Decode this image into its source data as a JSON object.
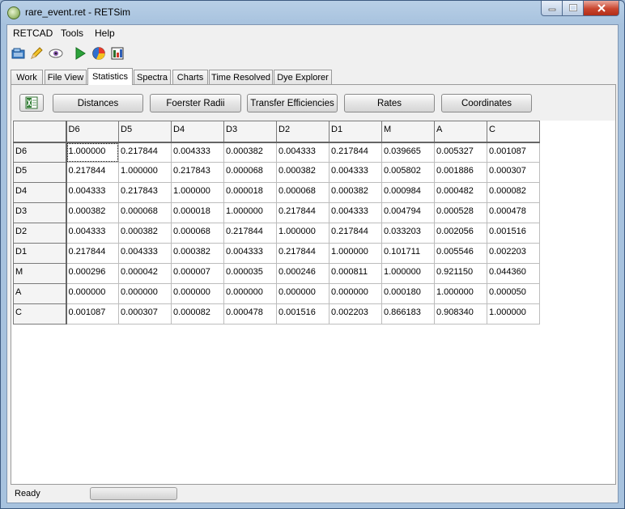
{
  "window": {
    "title": "rare_event.ret - RETSim"
  },
  "menu": [
    "RETCAD",
    "Tools",
    "Help"
  ],
  "toolbar": {
    "icons": [
      "open-folder-icon",
      "pencil-icon",
      "eye-icon",
      "play-icon",
      "pie-chart-icon",
      "spreadsheet-icon"
    ]
  },
  "tabs": [
    {
      "label": "Work",
      "active": false
    },
    {
      "label": "File View",
      "active": false
    },
    {
      "label": "Statistics",
      "active": true
    },
    {
      "label": "Spectra",
      "active": false
    },
    {
      "label": "Charts",
      "active": false
    },
    {
      "label": "Time Resolved",
      "active": false
    },
    {
      "label": "Dye Explorer",
      "active": false
    }
  ],
  "buttons": {
    "distances": "Distances",
    "foerster_radii": "Foerster Radii",
    "transfer_efficiencies": "Transfer Efficiencies",
    "rates": "Rates",
    "coordinates": "Coordinates"
  },
  "grid": {
    "columns": [
      "D6",
      "D5",
      "D4",
      "D3",
      "D2",
      "D1",
      "M",
      "A",
      "C"
    ],
    "rows": [
      {
        "label": "D6",
        "values": [
          "1.000000",
          "0.217844",
          "0.004333",
          "0.000382",
          "0.004333",
          "0.217844",
          "0.039665",
          "0.005327",
          "0.001087"
        ]
      },
      {
        "label": "D5",
        "values": [
          "0.217844",
          "1.000000",
          "0.217843",
          "0.000068",
          "0.000382",
          "0.004333",
          "0.005802",
          "0.001886",
          "0.000307"
        ]
      },
      {
        "label": "D4",
        "values": [
          "0.004333",
          "0.217843",
          "1.000000",
          "0.000018",
          "0.000068",
          "0.000382",
          "0.000984",
          "0.000482",
          "0.000082"
        ]
      },
      {
        "label": "D3",
        "values": [
          "0.000382",
          "0.000068",
          "0.000018",
          "1.000000",
          "0.217844",
          "0.004333",
          "0.004794",
          "0.000528",
          "0.000478"
        ]
      },
      {
        "label": "D2",
        "values": [
          "0.004333",
          "0.000382",
          "0.000068",
          "0.217844",
          "1.000000",
          "0.217844",
          "0.033203",
          "0.002056",
          "0.001516"
        ]
      },
      {
        "label": "D1",
        "values": [
          "0.217844",
          "0.004333",
          "0.000382",
          "0.004333",
          "0.217844",
          "1.000000",
          "0.101711",
          "0.005546",
          "0.002203"
        ]
      },
      {
        "label": "M",
        "values": [
          "0.000296",
          "0.000042",
          "0.000007",
          "0.000035",
          "0.000246",
          "0.000811",
          "1.000000",
          "0.921150",
          "0.044360"
        ]
      },
      {
        "label": "A",
        "values": [
          "0.000000",
          "0.000000",
          "0.000000",
          "0.000000",
          "0.000000",
          "0.000000",
          "0.000180",
          "1.000000",
          "0.000050"
        ]
      },
      {
        "label": "C",
        "values": [
          "0.001087",
          "0.000307",
          "0.000082",
          "0.000478",
          "0.001516",
          "0.002203",
          "0.866183",
          "0.908340",
          "1.000000"
        ]
      }
    ]
  },
  "status": {
    "text": "Ready",
    "progress": 0
  },
  "colors": {
    "progress_fill": "#6dd66a",
    "close_button": "#c9452e"
  }
}
